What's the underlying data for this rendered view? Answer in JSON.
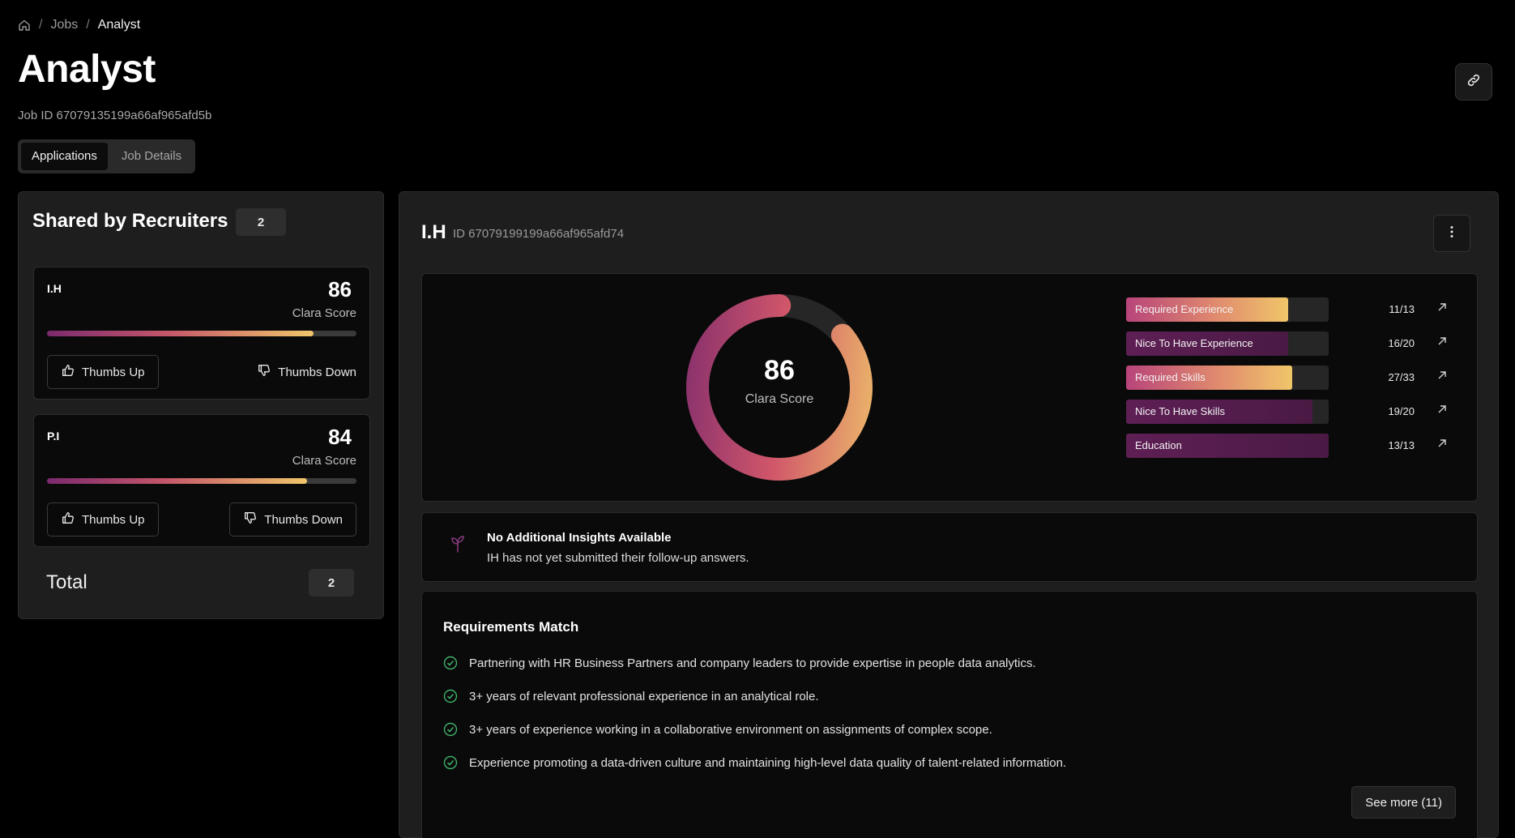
{
  "breadcrumb": {
    "home_icon": "home-icon",
    "separator": "/",
    "jobs": "Jobs",
    "current": "Analyst"
  },
  "page": {
    "title": "Analyst",
    "job_id": "Job ID 67079135199a66af965afd5b",
    "link_icon": "link-icon"
  },
  "tabs": [
    {
      "label": "Applications",
      "active": true
    },
    {
      "label": "Job Details",
      "active": false
    }
  ],
  "left_panel": {
    "title": "Shared by Recruiters",
    "count": "2",
    "candidates": [
      {
        "name": "I.H",
        "score": "86",
        "score_label": "Clara Score",
        "progress": 0.86,
        "thumbs_up": "Thumbs Up",
        "thumbs_down": "Thumbs Down"
      },
      {
        "name": "P.I",
        "score": "84",
        "score_label": "Clara Score",
        "progress": 0.84,
        "thumbs_up": "Thumbs Up",
        "thumbs_down": "Thumbs Down"
      }
    ],
    "total_label": "Total",
    "total_value": "2"
  },
  "detail": {
    "name": "I.H",
    "id": "ID 67079199199a66af965afd74",
    "menu_icon": "more-vertical-icon",
    "score": {
      "value": "86",
      "label": "Clara Score",
      "fraction": 0.86
    },
    "metrics": [
      {
        "label": "Required Experience",
        "value": "11/13",
        "fill": 0.8,
        "style": "gradient"
      },
      {
        "label": "Nice To Have Experience",
        "value": "16/20",
        "fill": 0.8,
        "style": "plain"
      },
      {
        "label": "Required Skills",
        "value": "27/33",
        "fill": 0.82,
        "style": "gradient"
      },
      {
        "label": "Nice To Have Skills",
        "value": "19/20",
        "fill": 0.92,
        "style": "plain"
      },
      {
        "label": "Education",
        "value": "13/13",
        "fill": 1.0,
        "style": "plain"
      }
    ],
    "insights": {
      "icon": "sprout-icon",
      "title": "No Additional Insights Available",
      "text": "IH has not yet submitted their follow-up answers."
    },
    "requirements": {
      "title": "Requirements Match",
      "items": [
        "Partnering with HR Business Partners and company leaders to provide expertise in people data analytics.",
        "3+ years of relevant professional experience in an analytical role.",
        "3+ years of experience working in a collaborative environment on assignments of complex scope.",
        "Experience promoting a data-driven culture and maintaining high-level data quality of talent-related information."
      ],
      "see_more": "See more (11)"
    }
  },
  "colors": {
    "accent_purple": "#7b2a6e",
    "accent_rose": "#c4566a",
    "accent_gold": "#f0c66a",
    "check_green": "#3fb26b"
  }
}
